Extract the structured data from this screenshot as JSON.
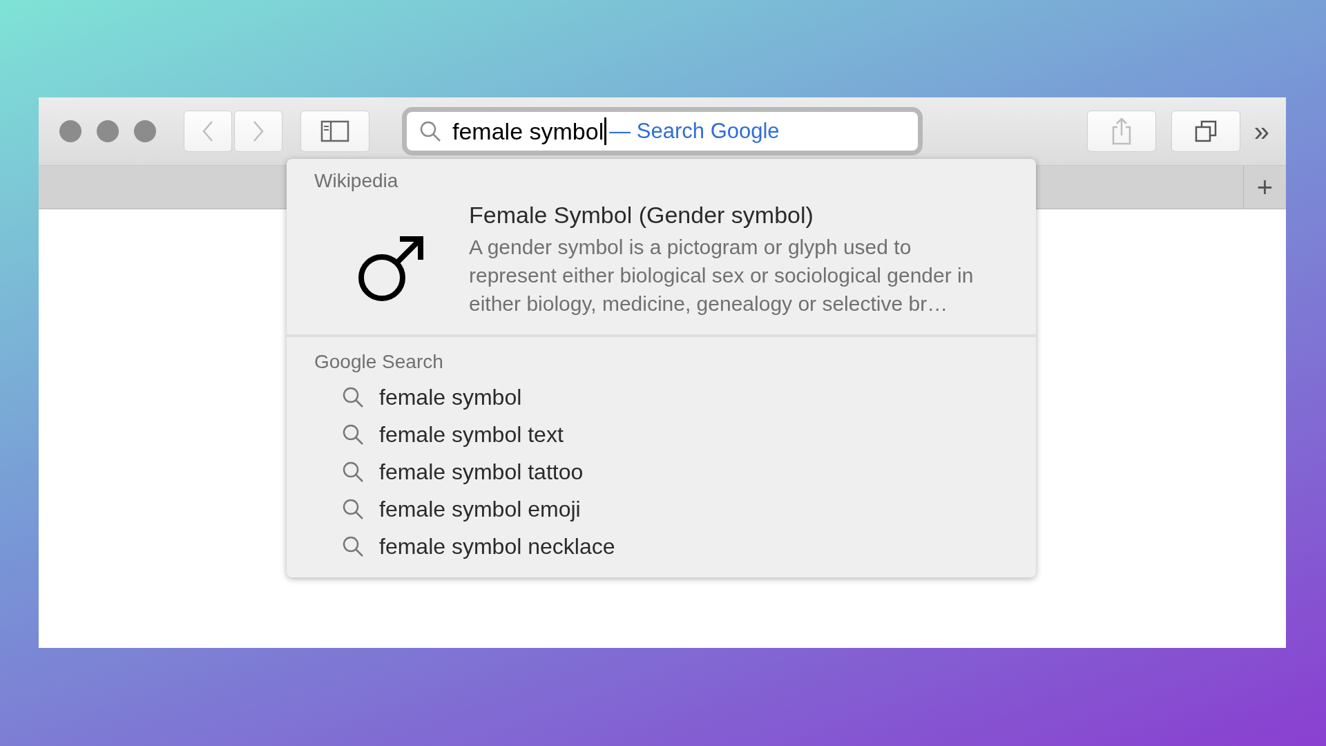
{
  "address_bar": {
    "value": "female symbol",
    "completion_hint": "— Search Google"
  },
  "tab_bar": {
    "new_tab_label": "+"
  },
  "overflow_label": "»",
  "dropdown": {
    "wikipedia": {
      "heading": "Wikipedia",
      "title": "Female Symbol (Gender symbol)",
      "summary": "A gender symbol is a pictogram or glyph used to represent either biological sex or sociological gender in either biology, medicine, genealogy or selective br…"
    },
    "google": {
      "heading": "Google Search",
      "suggestions": [
        "female symbol",
        "female symbol text",
        "female symbol tattoo",
        "female symbol emoji",
        "female symbol necklace"
      ]
    }
  }
}
